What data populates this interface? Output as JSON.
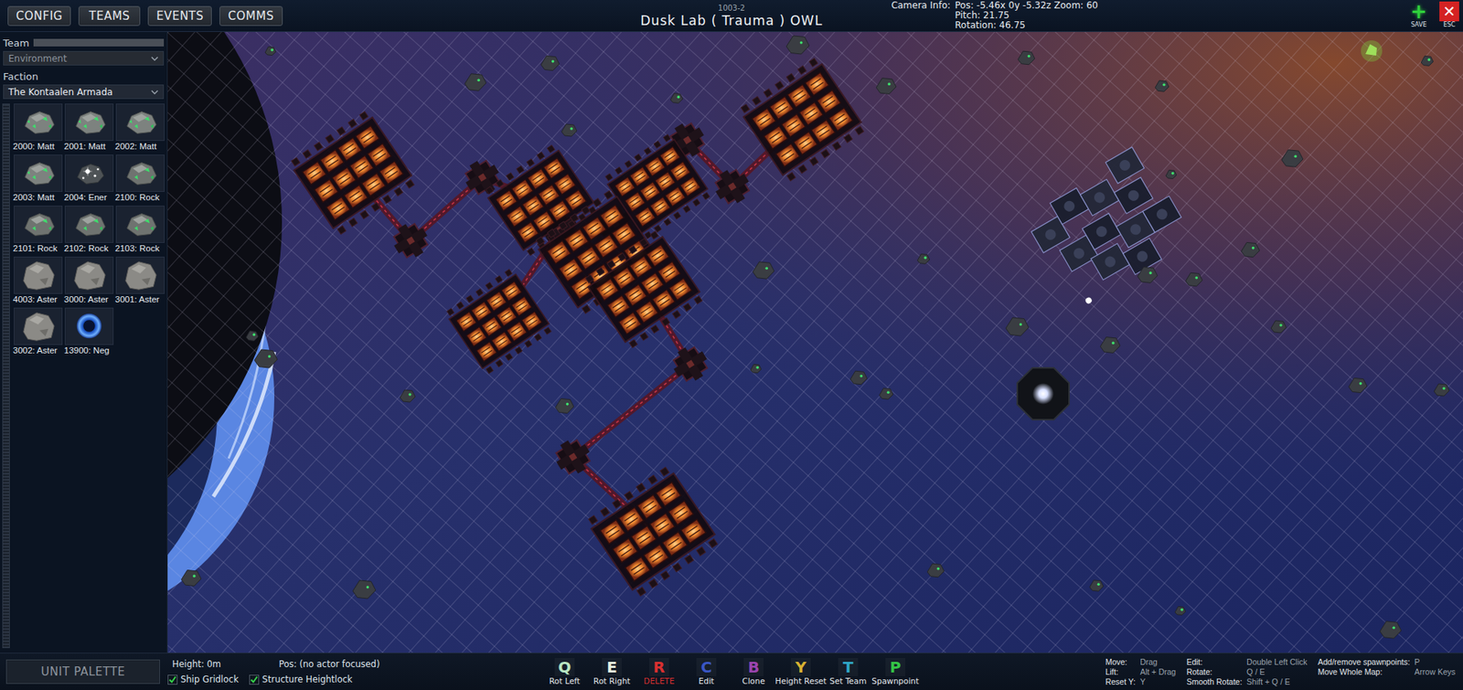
{
  "top_bar": {
    "menu": [
      {
        "label": "CONFIG"
      },
      {
        "label": "TEAMS"
      },
      {
        "label": "EVENTS"
      },
      {
        "label": "COMMS"
      }
    ],
    "map_id": "1003-2",
    "title": "Dusk Lab ( Trauma ) OWL",
    "camera": {
      "label": "Camera Info:",
      "lines": [
        "Pos: -5.46x 0y -5.32z Zoom: 60",
        "Pitch: 21.75",
        "Rotation: 46.75"
      ]
    },
    "actions": [
      {
        "icon": "+",
        "label": "SAVE",
        "color": "#2fd13c"
      },
      {
        "icon": "✕",
        "label": "ESC",
        "color": "#d42222"
      }
    ]
  },
  "sidebar": {
    "team": {
      "label": "Team",
      "value": "Environment",
      "disabled": true
    },
    "faction": {
      "label": "Faction",
      "value": "The Kontaalen Armada",
      "disabled": false
    },
    "units": [
      {
        "label": "2000: Matt",
        "kind": "matter"
      },
      {
        "label": "2001: Matt",
        "kind": "matter"
      },
      {
        "label": "2002: Matt",
        "kind": "matter"
      },
      {
        "label": "2003: Matt",
        "kind": "matter"
      },
      {
        "label": "2004: Ener",
        "kind": "energy"
      },
      {
        "label": "2100: Rock",
        "kind": "rock"
      },
      {
        "label": "2101: Rock",
        "kind": "rock"
      },
      {
        "label": "2102: Rock",
        "kind": "rock"
      },
      {
        "label": "2103: Rock",
        "kind": "rock"
      },
      {
        "label": "4003: Aster",
        "kind": "asteroid"
      },
      {
        "label": "3000: Aster",
        "kind": "asteroid"
      },
      {
        "label": "3001: Aster",
        "kind": "asteroid"
      },
      {
        "label": "3002: Aster",
        "kind": "asteroid"
      },
      {
        "label": "13900: Neg",
        "kind": "negative"
      }
    ]
  },
  "bottom_bar": {
    "palette_button": "UNIT PALETTE",
    "height": "Height: 0m",
    "pos": "Pos: (no actor focused)",
    "toggles": [
      {
        "label": "Ship Gridlock",
        "checked": true
      },
      {
        "label": "Structure Heightlock",
        "checked": true
      }
    ],
    "keys": [
      {
        "key": "Q",
        "label": "Rot Left",
        "color": "#b9e6c2",
        "danger": false
      },
      {
        "key": "E",
        "label": "Rot Right",
        "color": "#e6eee0",
        "danger": false
      },
      {
        "key": "R",
        "label": "DELETE",
        "color": "#d83030",
        "danger": true
      },
      {
        "key": "C",
        "label": "Edit",
        "color": "#3a56c4",
        "danger": false
      },
      {
        "key": "B",
        "label": "Clone",
        "color": "#9a44b0",
        "danger": false
      },
      {
        "key": "Y",
        "label": "Height Reset",
        "color": "#d8b232",
        "danger": false
      },
      {
        "key": "T",
        "label": "Set Team",
        "color": "#2fa6c6",
        "danger": false
      },
      {
        "key": "P",
        "label": "Spawnpoint",
        "color": "#34c446",
        "danger": false
      }
    ],
    "help": [
      [
        {
          "label": "Move:",
          "value": "Drag"
        },
        {
          "label": "Lift:",
          "value": "Alt + Drag"
        },
        {
          "label": "Reset Y:",
          "value": "Y"
        }
      ],
      [
        {
          "label": "Edit:",
          "value": "Double Left Click"
        },
        {
          "label": "Rotate:",
          "value": "Q / E"
        },
        {
          "label": "Smooth Rotate:",
          "value": "Shift + Q / E"
        }
      ],
      [
        {
          "label": "Add/remove spawnpoints:",
          "value": "P"
        },
        {
          "label": "Move Whole Map:",
          "value": "Arrow Keys"
        }
      ]
    ]
  }
}
